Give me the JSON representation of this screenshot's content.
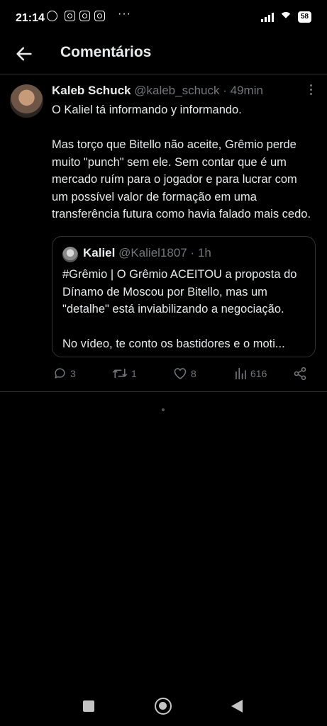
{
  "status_bar": {
    "time": "21:14",
    "battery": "58"
  },
  "header": {
    "title": "Comentários"
  },
  "tweet": {
    "name": "Kaleb Schuck",
    "handle": "@kaleb_schuck",
    "separator": "·",
    "time": "49min",
    "paragraphs": [
      "O Kaliel tá informando y informando.",
      "Mas torço que Bitello não aceite, Grêmio perde muito \"punch\" sem ele. Sem contar que é um mercado ruím para o jogador e para lucrar com um possível valor de formação em uma transferência futura como havia falado mais cedo."
    ],
    "quote": {
      "name": "Kaliel",
      "handle": "@Kaliel1807",
      "separator": "·",
      "time": "1h",
      "paragraphs": [
        "#Grêmio | O Grêmio ACEITOU a proposta do Dínamo de Moscou por Bitello, mas um \"detalhe\" está inviabilizando a negociação.",
        "No vídeo, te conto os bastidores e o moti..."
      ]
    },
    "actions": {
      "replies": "3",
      "retweets": "1",
      "likes": "8",
      "views": "616"
    }
  },
  "icons": {
    "back": "arrow-left-icon",
    "more": "more-vertical-icon",
    "reply": "comment-icon",
    "retweet": "retweet-icon",
    "like": "heart-icon",
    "views": "bar-chart-icon",
    "share": "share-icon"
  }
}
